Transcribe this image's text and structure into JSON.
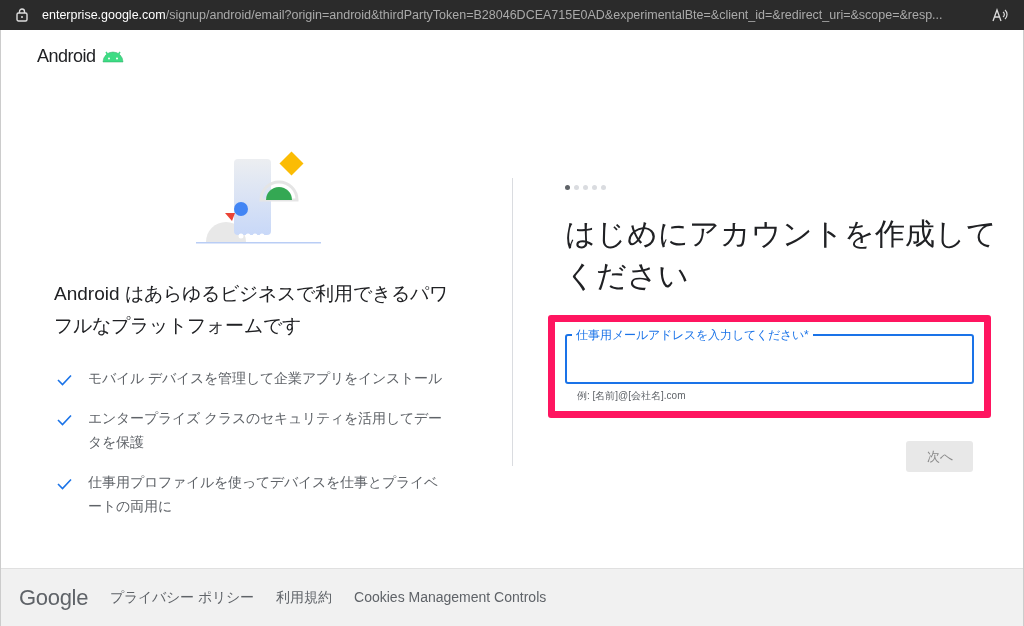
{
  "address_bar": {
    "url_host": "enterprise.google.com",
    "url_rest": "/signup/android/email?origin=android&thirdPartyToken=B28046DCEA715E0AD&experimentalBte=&client_id=&redirect_uri=&scope=&resp..."
  },
  "brand": {
    "name": "Android"
  },
  "intro": {
    "headline": "Android はあらゆるビジネスで利用できるパワフルなプラットフォームです",
    "features": [
      "モバイル デバイスを管理して企業アプリをインストール",
      "エンタープライズ クラスのセキュリティを活用してデータを保護",
      "仕事用プロファイルを使ってデバイスを仕事とプライベートの両用に"
    ]
  },
  "steps": [
    {
      "selected": true
    },
    {
      "selected": false
    },
    {
      "selected": false
    },
    {
      "selected": false
    },
    {
      "selected": false
    }
  ],
  "form": {
    "title": "はじめにアカウントを作成してください",
    "email_label": "仕事用メールアドレスを入力してください*",
    "email_hint": "例: [名前]@[会社名].com",
    "next_button": {
      "label": "次へ",
      "disabled": true
    }
  },
  "footer": {
    "logo": "Google",
    "links": [
      "プライバシー ポリシー",
      "利用規約",
      "Cookies Management Controls"
    ]
  }
}
